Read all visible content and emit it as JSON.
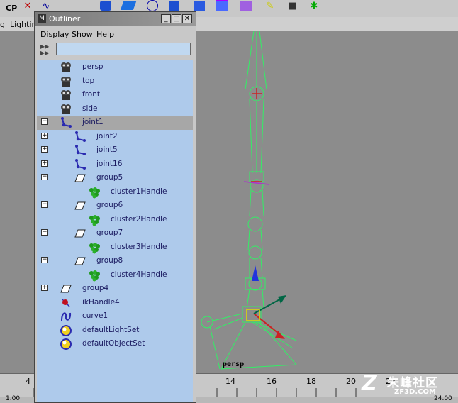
{
  "shelf": {
    "cp_label": "CP",
    "icons": [
      "cylinder-icon",
      "cube-icon",
      "cone-icon",
      "sphere-icon",
      "plane-icon",
      "torus-icon",
      "cube-wire-icon",
      "soft-body-icon",
      "paint-icon",
      "camera-icon",
      "light-icon"
    ]
  },
  "menubar": {
    "items": [
      "g",
      "Lightin"
    ]
  },
  "outliner": {
    "title": "Outliner",
    "menus": [
      "Display",
      "Show",
      "Help"
    ],
    "filter_value": "",
    "items": [
      {
        "label": "persp",
        "icon": "camera-icon",
        "depth": 0,
        "expander": "",
        "selected": false
      },
      {
        "label": "top",
        "icon": "camera-icon",
        "depth": 0,
        "expander": "",
        "selected": false
      },
      {
        "label": "front",
        "icon": "camera-icon",
        "depth": 0,
        "expander": "",
        "selected": false
      },
      {
        "label": "side",
        "icon": "camera-icon",
        "depth": 0,
        "expander": "",
        "selected": false
      },
      {
        "label": "joint1",
        "icon": "joint-icon",
        "depth": 0,
        "expander": "minus",
        "selected": true
      },
      {
        "label": "joint2",
        "icon": "joint-icon",
        "depth": 1,
        "expander": "plus",
        "selected": false
      },
      {
        "label": "joint5",
        "icon": "joint-icon",
        "depth": 1,
        "expander": "plus",
        "selected": false
      },
      {
        "label": "joint16",
        "icon": "joint-icon",
        "depth": 1,
        "expander": "plus",
        "selected": false
      },
      {
        "label": "group5",
        "icon": "group-icon",
        "depth": 1,
        "expander": "minus",
        "selected": false
      },
      {
        "label": "cluster1Handle",
        "icon": "cluster-icon",
        "depth": 2,
        "expander": "",
        "selected": false
      },
      {
        "label": "group6",
        "icon": "group-icon",
        "depth": 1,
        "expander": "minus",
        "selected": false
      },
      {
        "label": "cluster2Handle",
        "icon": "cluster-icon",
        "depth": 2,
        "expander": "",
        "selected": false
      },
      {
        "label": "group7",
        "icon": "group-icon",
        "depth": 1,
        "expander": "minus",
        "selected": false
      },
      {
        "label": "cluster3Handle",
        "icon": "cluster-icon",
        "depth": 2,
        "expander": "",
        "selected": false
      },
      {
        "label": "group8",
        "icon": "group-icon",
        "depth": 1,
        "expander": "minus",
        "selected": false
      },
      {
        "label": "cluster4Handle",
        "icon": "cluster-icon",
        "depth": 2,
        "expander": "",
        "selected": false
      },
      {
        "label": "group4",
        "icon": "group-icon",
        "depth": 0,
        "expander": "plus",
        "selected": false
      },
      {
        "label": "ikHandle4",
        "icon": "ikhandle-icon",
        "depth": 0,
        "expander": "",
        "selected": false
      },
      {
        "label": "curve1",
        "icon": "curve-icon",
        "depth": 0,
        "expander": "",
        "selected": false
      },
      {
        "label": "defaultLightSet",
        "icon": "set-icon",
        "depth": 0,
        "expander": "",
        "selected": false
      },
      {
        "label": "defaultObjectSet",
        "icon": "set-icon",
        "depth": 0,
        "expander": "",
        "selected": false
      }
    ]
  },
  "viewport": {
    "camera_label": "persp"
  },
  "timeline": {
    "ticks": [
      "4",
      "14",
      "16",
      "18",
      "20",
      "22"
    ],
    "left_value": "1.00",
    "right_value": "24.00"
  },
  "watermark": {
    "main": "朱峰社区",
    "sub": "ZF3D.COM"
  }
}
